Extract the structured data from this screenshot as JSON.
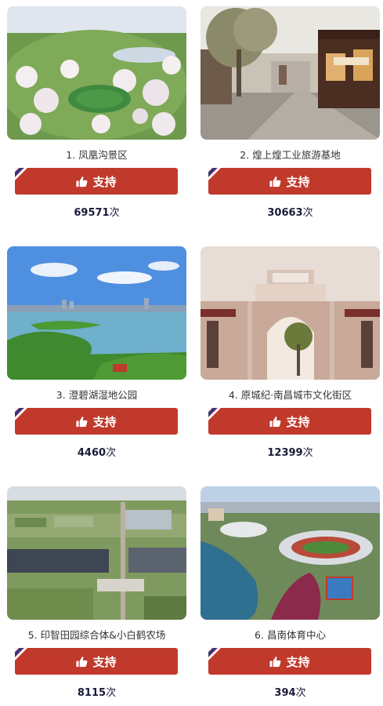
{
  "vote_label": "支持",
  "unit": "次",
  "items": [
    {
      "caption": "1. 凤凰沟景区",
      "votes": "69571"
    },
    {
      "caption": "2. 煌上煌工业旅游基地",
      "votes": "30663"
    },
    {
      "caption": "3. 澄碧湖湿地公园",
      "votes": "4460"
    },
    {
      "caption": "4. 原城纪·南昌城市文化街区",
      "votes": "12399"
    },
    {
      "caption": "5. 印智田园综合体&小白鹤农场",
      "votes": "8115"
    },
    {
      "caption": "6. 昌南体育中心",
      "votes": "394"
    }
  ],
  "colors": {
    "button": "#c0392b",
    "ribbon_blue": "#2b3a8c"
  }
}
